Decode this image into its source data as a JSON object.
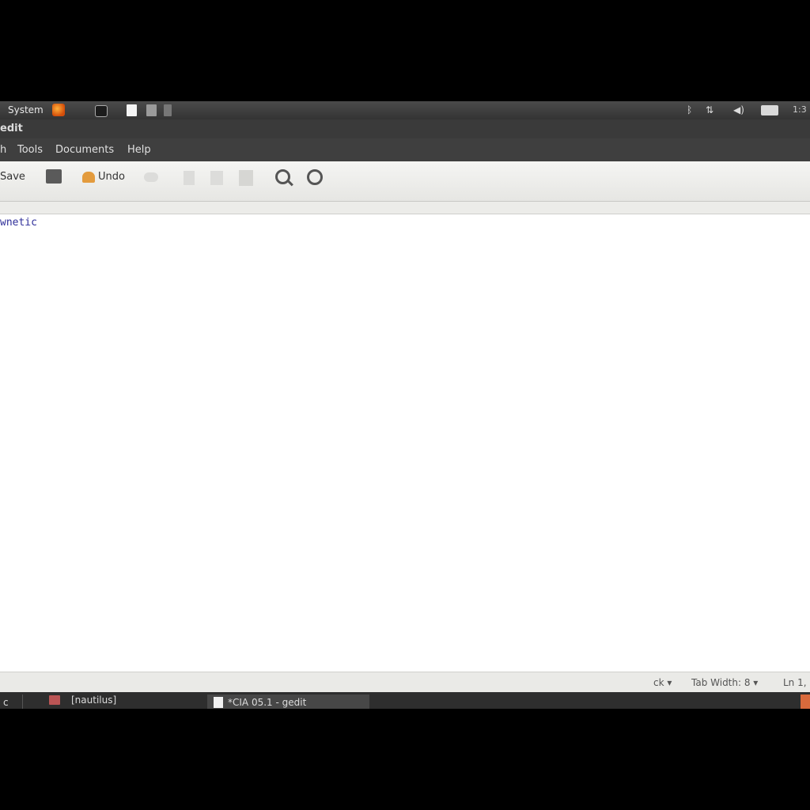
{
  "top_panel": {
    "system_menu_label": "System",
    "tray_icons": [
      "bluetooth-icon",
      "network-icon",
      "volume-icon",
      "mail-icon"
    ],
    "clock": "1:3"
  },
  "title_bar": {
    "title": "edit"
  },
  "menu_bar": {
    "items": [
      "h",
      "Tools",
      "Documents",
      "Help"
    ]
  },
  "toolbar": {
    "save_label": "Save",
    "undo_label": "Undo"
  },
  "editor": {
    "text": "wnetic"
  },
  "status_bar": {
    "language": "ck ▾",
    "tab_width": "Tab Width: 8 ▾",
    "cursor_position": "Ln 1,"
  },
  "bottom_panel": {
    "show_desktop_label": "c",
    "tasks": [
      {
        "label": "[nautilus]"
      },
      {
        "label": "*CIA 05.1 - gedit"
      }
    ]
  },
  "colors": {
    "panel": "#343434",
    "toolbar": "#eeeeec",
    "editor_bg": "#ffffff",
    "editor_text": "#2f2f9a",
    "accent": "#e39b3d"
  }
}
